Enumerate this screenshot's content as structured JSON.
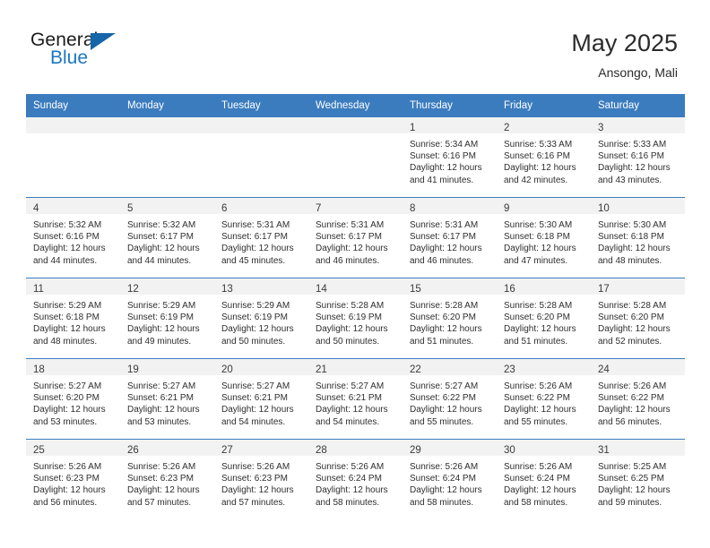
{
  "brand": {
    "name_part1": "General",
    "name_part2": "Blue",
    "triangle_color": "#1565a8",
    "blue_text_color": "#1b76c4"
  },
  "header": {
    "title": "May 2025",
    "subtitle": "Ansongo, Mali"
  },
  "theme": {
    "header_row_bg": "#3b7cbf",
    "header_row_text": "#ffffff",
    "daynum_band_bg": "#f2f2f2",
    "cell_border": "#3b7cbf",
    "body_bg": "#ffffff"
  },
  "weekday_headers": [
    "Sunday",
    "Monday",
    "Tuesday",
    "Wednesday",
    "Thursday",
    "Friday",
    "Saturday"
  ],
  "weeks": [
    [
      {
        "day": "",
        "empty": true,
        "sunrise": "",
        "sunset": "",
        "daylight_line1": "",
        "daylight_line2": ""
      },
      {
        "day": "",
        "empty": true,
        "sunrise": "",
        "sunset": "",
        "daylight_line1": "",
        "daylight_line2": ""
      },
      {
        "day": "",
        "empty": true,
        "sunrise": "",
        "sunset": "",
        "daylight_line1": "",
        "daylight_line2": ""
      },
      {
        "day": "",
        "empty": true,
        "sunrise": "",
        "sunset": "",
        "daylight_line1": "",
        "daylight_line2": ""
      },
      {
        "day": "1",
        "empty": false,
        "sunrise": "Sunrise: 5:34 AM",
        "sunset": "Sunset: 6:16 PM",
        "daylight_line1": "Daylight: 12 hours",
        "daylight_line2": "and 41 minutes."
      },
      {
        "day": "2",
        "empty": false,
        "sunrise": "Sunrise: 5:33 AM",
        "sunset": "Sunset: 6:16 PM",
        "daylight_line1": "Daylight: 12 hours",
        "daylight_line2": "and 42 minutes."
      },
      {
        "day": "3",
        "empty": false,
        "sunrise": "Sunrise: 5:33 AM",
        "sunset": "Sunset: 6:16 PM",
        "daylight_line1": "Daylight: 12 hours",
        "daylight_line2": "and 43 minutes."
      }
    ],
    [
      {
        "day": "4",
        "empty": false,
        "sunrise": "Sunrise: 5:32 AM",
        "sunset": "Sunset: 6:16 PM",
        "daylight_line1": "Daylight: 12 hours",
        "daylight_line2": "and 44 minutes."
      },
      {
        "day": "5",
        "empty": false,
        "sunrise": "Sunrise: 5:32 AM",
        "sunset": "Sunset: 6:17 PM",
        "daylight_line1": "Daylight: 12 hours",
        "daylight_line2": "and 44 minutes."
      },
      {
        "day": "6",
        "empty": false,
        "sunrise": "Sunrise: 5:31 AM",
        "sunset": "Sunset: 6:17 PM",
        "daylight_line1": "Daylight: 12 hours",
        "daylight_line2": "and 45 minutes."
      },
      {
        "day": "7",
        "empty": false,
        "sunrise": "Sunrise: 5:31 AM",
        "sunset": "Sunset: 6:17 PM",
        "daylight_line1": "Daylight: 12 hours",
        "daylight_line2": "and 46 minutes."
      },
      {
        "day": "8",
        "empty": false,
        "sunrise": "Sunrise: 5:31 AM",
        "sunset": "Sunset: 6:17 PM",
        "daylight_line1": "Daylight: 12 hours",
        "daylight_line2": "and 46 minutes."
      },
      {
        "day": "9",
        "empty": false,
        "sunrise": "Sunrise: 5:30 AM",
        "sunset": "Sunset: 6:18 PM",
        "daylight_line1": "Daylight: 12 hours",
        "daylight_line2": "and 47 minutes."
      },
      {
        "day": "10",
        "empty": false,
        "sunrise": "Sunrise: 5:30 AM",
        "sunset": "Sunset: 6:18 PM",
        "daylight_line1": "Daylight: 12 hours",
        "daylight_line2": "and 48 minutes."
      }
    ],
    [
      {
        "day": "11",
        "empty": false,
        "sunrise": "Sunrise: 5:29 AM",
        "sunset": "Sunset: 6:18 PM",
        "daylight_line1": "Daylight: 12 hours",
        "daylight_line2": "and 48 minutes."
      },
      {
        "day": "12",
        "empty": false,
        "sunrise": "Sunrise: 5:29 AM",
        "sunset": "Sunset: 6:19 PM",
        "daylight_line1": "Daylight: 12 hours",
        "daylight_line2": "and 49 minutes."
      },
      {
        "day": "13",
        "empty": false,
        "sunrise": "Sunrise: 5:29 AM",
        "sunset": "Sunset: 6:19 PM",
        "daylight_line1": "Daylight: 12 hours",
        "daylight_line2": "and 50 minutes."
      },
      {
        "day": "14",
        "empty": false,
        "sunrise": "Sunrise: 5:28 AM",
        "sunset": "Sunset: 6:19 PM",
        "daylight_line1": "Daylight: 12 hours",
        "daylight_line2": "and 50 minutes."
      },
      {
        "day": "15",
        "empty": false,
        "sunrise": "Sunrise: 5:28 AM",
        "sunset": "Sunset: 6:20 PM",
        "daylight_line1": "Daylight: 12 hours",
        "daylight_line2": "and 51 minutes."
      },
      {
        "day": "16",
        "empty": false,
        "sunrise": "Sunrise: 5:28 AM",
        "sunset": "Sunset: 6:20 PM",
        "daylight_line1": "Daylight: 12 hours",
        "daylight_line2": "and 51 minutes."
      },
      {
        "day": "17",
        "empty": false,
        "sunrise": "Sunrise: 5:28 AM",
        "sunset": "Sunset: 6:20 PM",
        "daylight_line1": "Daylight: 12 hours",
        "daylight_line2": "and 52 minutes."
      }
    ],
    [
      {
        "day": "18",
        "empty": false,
        "sunrise": "Sunrise: 5:27 AM",
        "sunset": "Sunset: 6:20 PM",
        "daylight_line1": "Daylight: 12 hours",
        "daylight_line2": "and 53 minutes."
      },
      {
        "day": "19",
        "empty": false,
        "sunrise": "Sunrise: 5:27 AM",
        "sunset": "Sunset: 6:21 PM",
        "daylight_line1": "Daylight: 12 hours",
        "daylight_line2": "and 53 minutes."
      },
      {
        "day": "20",
        "empty": false,
        "sunrise": "Sunrise: 5:27 AM",
        "sunset": "Sunset: 6:21 PM",
        "daylight_line1": "Daylight: 12 hours",
        "daylight_line2": "and 54 minutes."
      },
      {
        "day": "21",
        "empty": false,
        "sunrise": "Sunrise: 5:27 AM",
        "sunset": "Sunset: 6:21 PM",
        "daylight_line1": "Daylight: 12 hours",
        "daylight_line2": "and 54 minutes."
      },
      {
        "day": "22",
        "empty": false,
        "sunrise": "Sunrise: 5:27 AM",
        "sunset": "Sunset: 6:22 PM",
        "daylight_line1": "Daylight: 12 hours",
        "daylight_line2": "and 55 minutes."
      },
      {
        "day": "23",
        "empty": false,
        "sunrise": "Sunrise: 5:26 AM",
        "sunset": "Sunset: 6:22 PM",
        "daylight_line1": "Daylight: 12 hours",
        "daylight_line2": "and 55 minutes."
      },
      {
        "day": "24",
        "empty": false,
        "sunrise": "Sunrise: 5:26 AM",
        "sunset": "Sunset: 6:22 PM",
        "daylight_line1": "Daylight: 12 hours",
        "daylight_line2": "and 56 minutes."
      }
    ],
    [
      {
        "day": "25",
        "empty": false,
        "sunrise": "Sunrise: 5:26 AM",
        "sunset": "Sunset: 6:23 PM",
        "daylight_line1": "Daylight: 12 hours",
        "daylight_line2": "and 56 minutes."
      },
      {
        "day": "26",
        "empty": false,
        "sunrise": "Sunrise: 5:26 AM",
        "sunset": "Sunset: 6:23 PM",
        "daylight_line1": "Daylight: 12 hours",
        "daylight_line2": "and 57 minutes."
      },
      {
        "day": "27",
        "empty": false,
        "sunrise": "Sunrise: 5:26 AM",
        "sunset": "Sunset: 6:23 PM",
        "daylight_line1": "Daylight: 12 hours",
        "daylight_line2": "and 57 minutes."
      },
      {
        "day": "28",
        "empty": false,
        "sunrise": "Sunrise: 5:26 AM",
        "sunset": "Sunset: 6:24 PM",
        "daylight_line1": "Daylight: 12 hours",
        "daylight_line2": "and 58 minutes."
      },
      {
        "day": "29",
        "empty": false,
        "sunrise": "Sunrise: 5:26 AM",
        "sunset": "Sunset: 6:24 PM",
        "daylight_line1": "Daylight: 12 hours",
        "daylight_line2": "and 58 minutes."
      },
      {
        "day": "30",
        "empty": false,
        "sunrise": "Sunrise: 5:26 AM",
        "sunset": "Sunset: 6:24 PM",
        "daylight_line1": "Daylight: 12 hours",
        "daylight_line2": "and 58 minutes."
      },
      {
        "day": "31",
        "empty": false,
        "sunrise": "Sunrise: 5:25 AM",
        "sunset": "Sunset: 6:25 PM",
        "daylight_line1": "Daylight: 12 hours",
        "daylight_line2": "and 59 minutes."
      }
    ]
  ]
}
